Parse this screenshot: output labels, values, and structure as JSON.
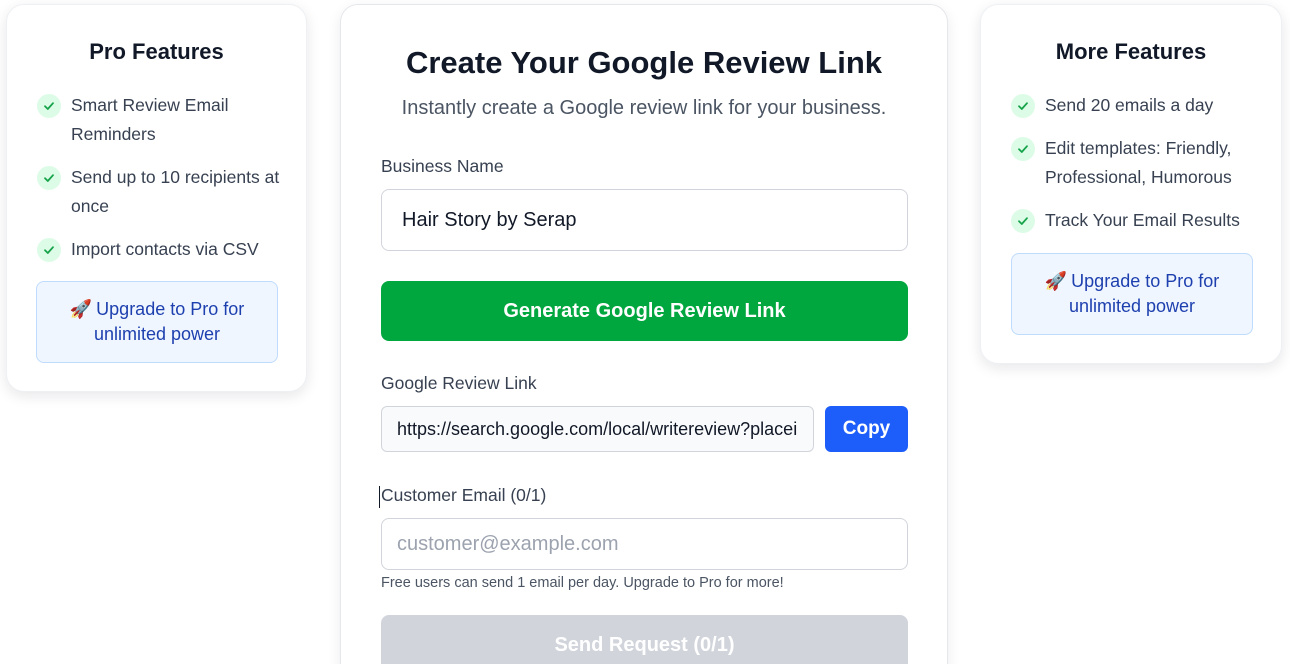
{
  "left_card": {
    "title": "Pro Features",
    "features": [
      "Smart Review Email Reminders",
      "Send up to 10 recipients at once",
      "Import contacts via CSV"
    ],
    "upgrade_text": "Upgrade to Pro for unlimited power",
    "upgrade_icon": "rocket-icon"
  },
  "main": {
    "title": "Create Your Google Review Link",
    "subtitle": "Instantly create a Google review link for your business.",
    "business_label": "Business Name",
    "business_value": "Hair Story by Serap",
    "generate_label": "Generate Google Review Link",
    "link_label": "Google Review Link",
    "link_value": "https://search.google.com/local/writereview?placeid=",
    "copy_label": "Copy",
    "email_label": "Customer Email (0/1)",
    "email_placeholder": "customer@example.com",
    "hint": "Free users can send 1 email per day. Upgrade to Pro for more!",
    "send_label": "Send Request (0/1)"
  },
  "right_card": {
    "title": "More Features",
    "features": [
      "Send 20 emails a day",
      "Edit templates: Friendly, Professional, Humorous",
      "Track Your Email Results"
    ],
    "upgrade_text": "Upgrade to Pro for unlimited power",
    "upgrade_icon": "rocket-icon"
  },
  "colors": {
    "generate_green": "#00a63e",
    "copy_blue": "#1d5dfa",
    "check_bg": "#dcfce7",
    "check_stroke": "#16a34a",
    "upgrade_bg": "#eff6ff",
    "upgrade_text": "#1e40af",
    "disabled_button": "#d1d5db"
  }
}
